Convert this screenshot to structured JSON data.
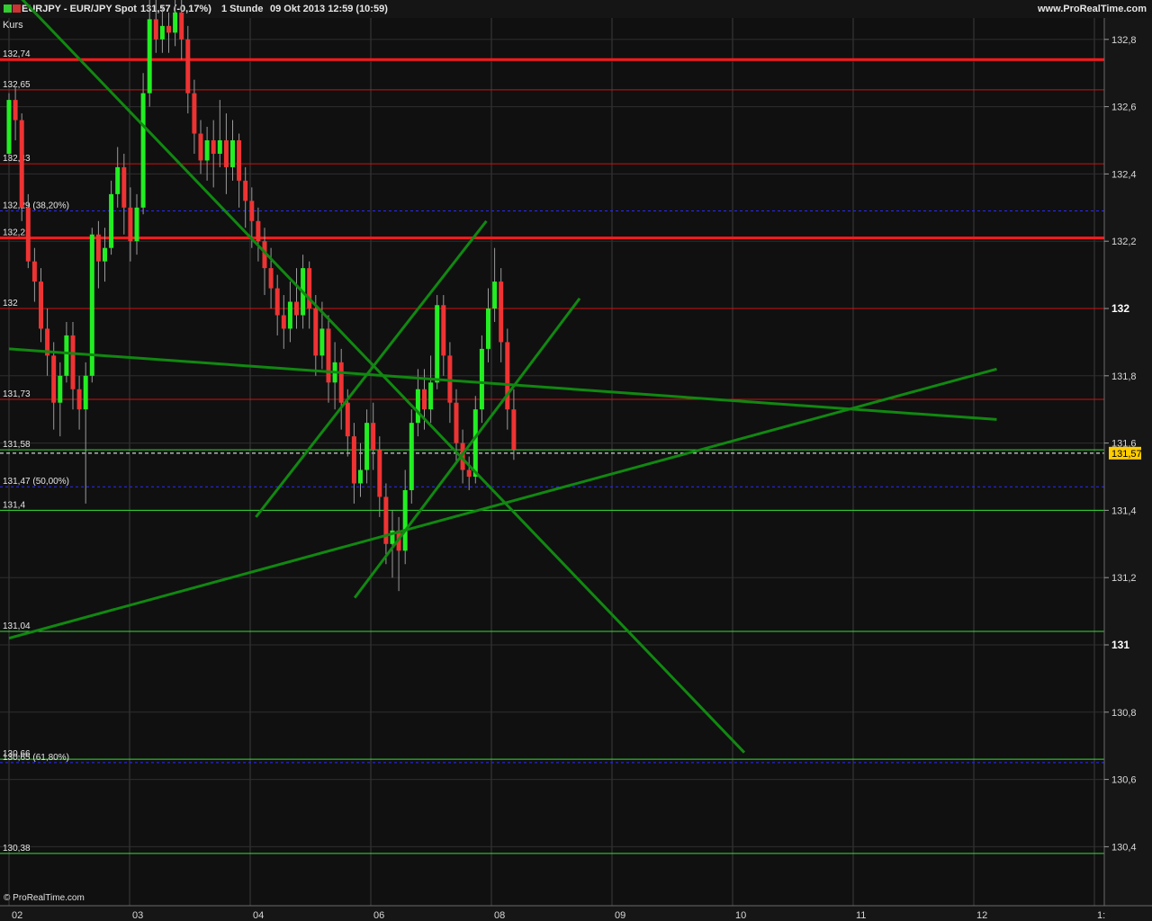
{
  "title_bar": {
    "symbol": "EURJPY - EUR/JPY Spot",
    "quote": "131,57 (-0,17%)",
    "timeframe": "1 Stunde",
    "date": "09 Okt 2013 12:59 (10:59)",
    "website": "www.ProRealTime.com"
  },
  "panel_label": "Kurs",
  "copyright": "© ProRealTime.com",
  "last_price_label": "131,57",
  "chart_data": {
    "type": "candlestick",
    "instrument": "EUR/JPY",
    "ylim": [
      130.0,
      132.86
    ],
    "y_ticks": [
      {
        "value": 132.8,
        "label": "132,8",
        "bold": false
      },
      {
        "value": 132.6,
        "label": "132,6",
        "bold": false
      },
      {
        "value": 132.4,
        "label": "132,4",
        "bold": false
      },
      {
        "value": 132.2,
        "label": "132,2",
        "bold": false
      },
      {
        "value": 132.0,
        "label": "132",
        "bold": true
      },
      {
        "value": 131.8,
        "label": "131,8",
        "bold": false
      },
      {
        "value": 131.6,
        "label": "131,6",
        "bold": false
      },
      {
        "value": 131.4,
        "label": "131,4",
        "bold": false
      },
      {
        "value": 131.2,
        "label": "131,2",
        "bold": false
      },
      {
        "value": 131.0,
        "label": "131",
        "bold": true
      },
      {
        "value": 130.8,
        "label": "130,8",
        "bold": false
      },
      {
        "value": 130.6,
        "label": "130,6",
        "bold": false
      },
      {
        "value": 130.4,
        "label": "130,4",
        "bold": false
      }
    ],
    "x_ticks": [
      {
        "t": 0,
        "label": "02"
      },
      {
        "t": 20,
        "label": "03"
      },
      {
        "t": 40,
        "label": "04"
      },
      {
        "t": 60,
        "label": "06"
      },
      {
        "t": 80,
        "label": "08"
      },
      {
        "t": 100,
        "label": "09"
      },
      {
        "t": 120,
        "label": "10"
      },
      {
        "t": 140,
        "label": "11"
      },
      {
        "t": 160,
        "label": "12"
      },
      {
        "t": 180,
        "label": "1:"
      }
    ],
    "levels": [
      {
        "value": 132.74,
        "label": "132,74",
        "color": "#ff1a1a",
        "width": 3,
        "dash": ""
      },
      {
        "value": 132.65,
        "label": "132,65",
        "color": "#d01010",
        "width": 1,
        "dash": ""
      },
      {
        "value": 132.43,
        "label": "132,43",
        "color": "#d01010",
        "width": 1,
        "dash": ""
      },
      {
        "value": 132.29,
        "label": "132,29 (38,20%)",
        "color": "#2a2aff",
        "width": 1,
        "dash": "3,3"
      },
      {
        "value": 132.21,
        "label": "132,21",
        "color": "#ff1a1a",
        "width": 3,
        "dash": ""
      },
      {
        "value": 132.0,
        "label": "132",
        "color": "#d01010",
        "width": 1,
        "dash": ""
      },
      {
        "value": 131.73,
        "label": "131,73",
        "color": "#d01010",
        "width": 1,
        "dash": ""
      },
      {
        "value": 131.58,
        "label": "131,58",
        "color": "#33dd33",
        "width": 1,
        "dash": ""
      },
      {
        "value": 131.47,
        "label": "131,47 (50,00%)",
        "color": "#2a2aff",
        "width": 1,
        "dash": "3,3"
      },
      {
        "value": 131.4,
        "label": "131,4",
        "color": "#33dd33",
        "width": 1,
        "dash": ""
      },
      {
        "value": 131.04,
        "label": "131,04",
        "color": "#33dd33",
        "width": 1,
        "dash": ""
      },
      {
        "value": 130.66,
        "label": "130,66",
        "color": "#33dd33",
        "width": 1,
        "dash": ""
      },
      {
        "value": 130.65,
        "label": "130,65 (61,80%)",
        "color": "#2a2aff",
        "width": 1,
        "dash": "3,3"
      },
      {
        "value": 130.38,
        "label": "130,38",
        "color": "#33dd33",
        "width": 1,
        "dash": ""
      }
    ],
    "last_price": 131.57,
    "trendlines": [
      {
        "t1": 0,
        "v1": 132.96,
        "t2": 134,
        "v2": 130.68
      },
      {
        "t1": 0,
        "v1": 131.88,
        "t2": 180,
        "v2": 131.67
      },
      {
        "t1": 0,
        "v1": 131.02,
        "t2": 180,
        "v2": 131.82
      },
      {
        "t1": 45,
        "v1": 131.38,
        "t2": 87,
        "v2": 132.26
      },
      {
        "t1": 63,
        "v1": 131.14,
        "t2": 104,
        "v2": 132.03
      }
    ],
    "candles": [
      [
        132.46,
        132.62,
        132.64,
        132.44
      ],
      [
        132.62,
        132.56,
        132.66,
        132.5
      ],
      [
        132.56,
        132.3,
        132.58,
        132.26
      ],
      [
        132.3,
        132.14,
        132.34,
        132.12
      ],
      [
        132.14,
        132.08,
        132.18,
        132.02
      ],
      [
        132.08,
        131.94,
        132.12,
        131.9
      ],
      [
        131.94,
        131.86,
        132.0,
        131.8
      ],
      [
        131.86,
        131.72,
        131.9,
        131.64
      ],
      [
        131.72,
        131.8,
        131.84,
        131.62
      ],
      [
        131.8,
        131.92,
        131.96,
        131.78
      ],
      [
        131.92,
        131.76,
        131.96,
        131.7
      ],
      [
        131.76,
        131.7,
        131.8,
        131.64
      ],
      [
        131.7,
        131.8,
        131.84,
        131.42
      ],
      [
        131.8,
        132.22,
        132.24,
        131.78
      ],
      [
        132.22,
        132.14,
        132.26,
        132.06
      ],
      [
        132.14,
        132.18,
        132.24,
        132.08
      ],
      [
        132.18,
        132.34,
        132.38,
        132.16
      ],
      [
        132.34,
        132.42,
        132.48,
        132.3
      ],
      [
        132.42,
        132.3,
        132.46,
        132.22
      ],
      [
        132.3,
        132.2,
        132.36,
        132.14
      ],
      [
        132.2,
        132.3,
        132.34,
        132.16
      ],
      [
        132.3,
        132.64,
        132.7,
        132.28
      ],
      [
        132.64,
        132.86,
        132.92,
        132.6
      ],
      [
        132.86,
        132.8,
        132.92,
        132.76
      ],
      [
        132.8,
        132.84,
        132.9,
        132.76
      ],
      [
        132.84,
        132.82,
        132.88,
        132.76
      ],
      [
        132.82,
        132.88,
        132.94,
        132.78
      ],
      [
        132.88,
        132.8,
        132.92,
        132.74
      ],
      [
        132.8,
        132.64,
        132.84,
        132.58
      ],
      [
        132.64,
        132.52,
        132.68,
        132.46
      ],
      [
        132.52,
        132.44,
        132.56,
        132.4
      ],
      [
        132.44,
        132.5,
        132.54,
        132.38
      ],
      [
        132.5,
        132.46,
        132.56,
        132.36
      ],
      [
        132.46,
        132.5,
        132.62,
        132.42
      ],
      [
        132.5,
        132.42,
        132.58,
        132.34
      ],
      [
        132.42,
        132.5,
        132.56,
        132.38
      ],
      [
        132.5,
        132.38,
        132.52,
        132.3
      ],
      [
        132.38,
        132.32,
        132.42,
        132.24
      ],
      [
        132.32,
        132.26,
        132.36,
        132.18
      ],
      [
        132.26,
        132.2,
        132.3,
        132.14
      ],
      [
        132.2,
        132.12,
        132.24,
        132.04
      ],
      [
        132.12,
        132.06,
        132.18,
        132.0
      ],
      [
        132.06,
        131.98,
        132.1,
        131.92
      ],
      [
        131.98,
        131.94,
        132.04,
        131.88
      ],
      [
        131.94,
        132.02,
        132.08,
        131.9
      ],
      [
        132.02,
        131.98,
        132.12,
        131.94
      ],
      [
        131.98,
        132.12,
        132.16,
        131.94
      ],
      [
        132.12,
        132.0,
        132.14,
        131.94
      ],
      [
        132.0,
        131.86,
        132.04,
        131.8
      ],
      [
        131.86,
        131.94,
        132.02,
        131.82
      ],
      [
        131.94,
        131.78,
        131.98,
        131.72
      ],
      [
        131.78,
        131.84,
        131.9,
        131.7
      ],
      [
        131.84,
        131.72,
        131.88,
        131.64
      ],
      [
        131.72,
        131.62,
        131.76,
        131.56
      ],
      [
        131.62,
        131.48,
        131.66,
        131.42
      ],
      [
        131.48,
        131.52,
        131.6,
        131.44
      ],
      [
        131.52,
        131.66,
        131.7,
        131.48
      ],
      [
        131.66,
        131.58,
        131.72,
        131.52
      ],
      [
        131.58,
        131.44,
        131.62,
        131.38
      ],
      [
        131.44,
        131.3,
        131.48,
        131.24
      ],
      [
        131.3,
        131.34,
        131.4,
        131.2
      ],
      [
        131.34,
        131.28,
        131.38,
        131.16
      ],
      [
        131.28,
        131.46,
        131.52,
        131.24
      ],
      [
        131.46,
        131.66,
        131.7,
        131.42
      ],
      [
        131.66,
        131.76,
        131.82,
        131.62
      ],
      [
        131.76,
        131.7,
        131.82,
        131.64
      ],
      [
        131.7,
        131.78,
        131.86,
        131.66
      ],
      [
        131.78,
        132.01,
        132.04,
        131.76
      ],
      [
        132.01,
        131.86,
        132.04,
        131.8
      ],
      [
        131.86,
        131.72,
        131.9,
        131.66
      ],
      [
        131.72,
        131.6,
        131.76,
        131.54
      ],
      [
        131.6,
        131.52,
        131.64,
        131.48
      ],
      [
        131.52,
        131.5,
        131.56,
        131.46
      ],
      [
        131.5,
        131.7,
        131.74,
        131.48
      ],
      [
        131.7,
        131.88,
        131.92,
        131.66
      ],
      [
        131.88,
        132.0,
        132.06,
        131.84
      ],
      [
        132.0,
        132.08,
        132.18,
        131.96
      ],
      [
        132.08,
        131.9,
        132.12,
        131.84
      ],
      [
        131.9,
        131.7,
        131.94,
        131.64
      ],
      [
        131.7,
        131.58,
        131.76,
        131.55
      ]
    ]
  }
}
